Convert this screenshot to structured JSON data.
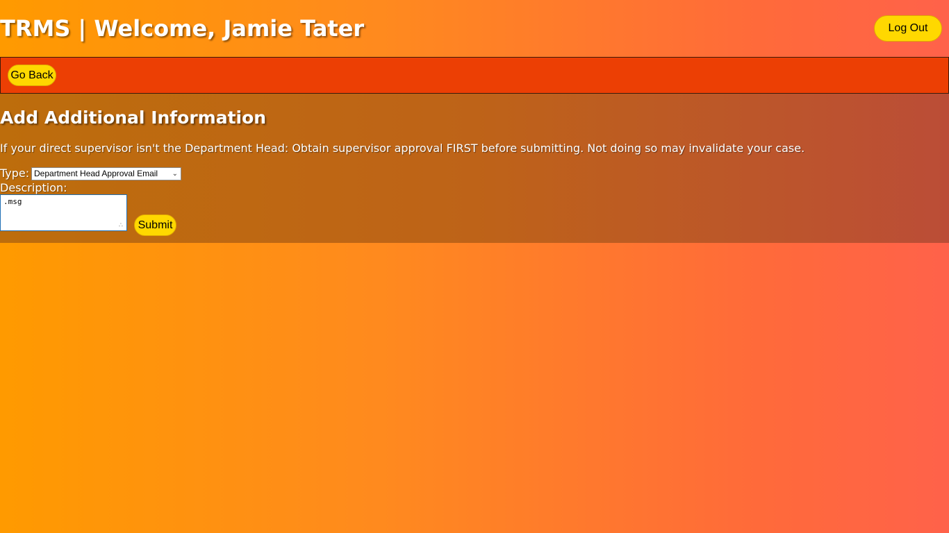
{
  "header": {
    "title": "TRMS | Welcome, Jamie Tater",
    "logout_label": "Log Out"
  },
  "nav": {
    "back_label": "Go Back"
  },
  "form": {
    "title": "Add Additional Information",
    "notice": "If your direct supervisor isn't the Department Head: Obtain supervisor approval FIRST before submitting. Not doing so may invalidate your case.",
    "type_label": "Type:",
    "type_selected": "Department Head Approval Email",
    "description_label": "Description:",
    "description_value": ".msg",
    "submit_label": "Submit"
  },
  "colors": {
    "button_bg": "#ffd800",
    "nav_bar_bg": "#ec3f04",
    "panel_bg": "#be6318"
  },
  "icons": {
    "select_arrow": "chevron-down-icon",
    "textarea_grip": "resize-grip-icon"
  }
}
